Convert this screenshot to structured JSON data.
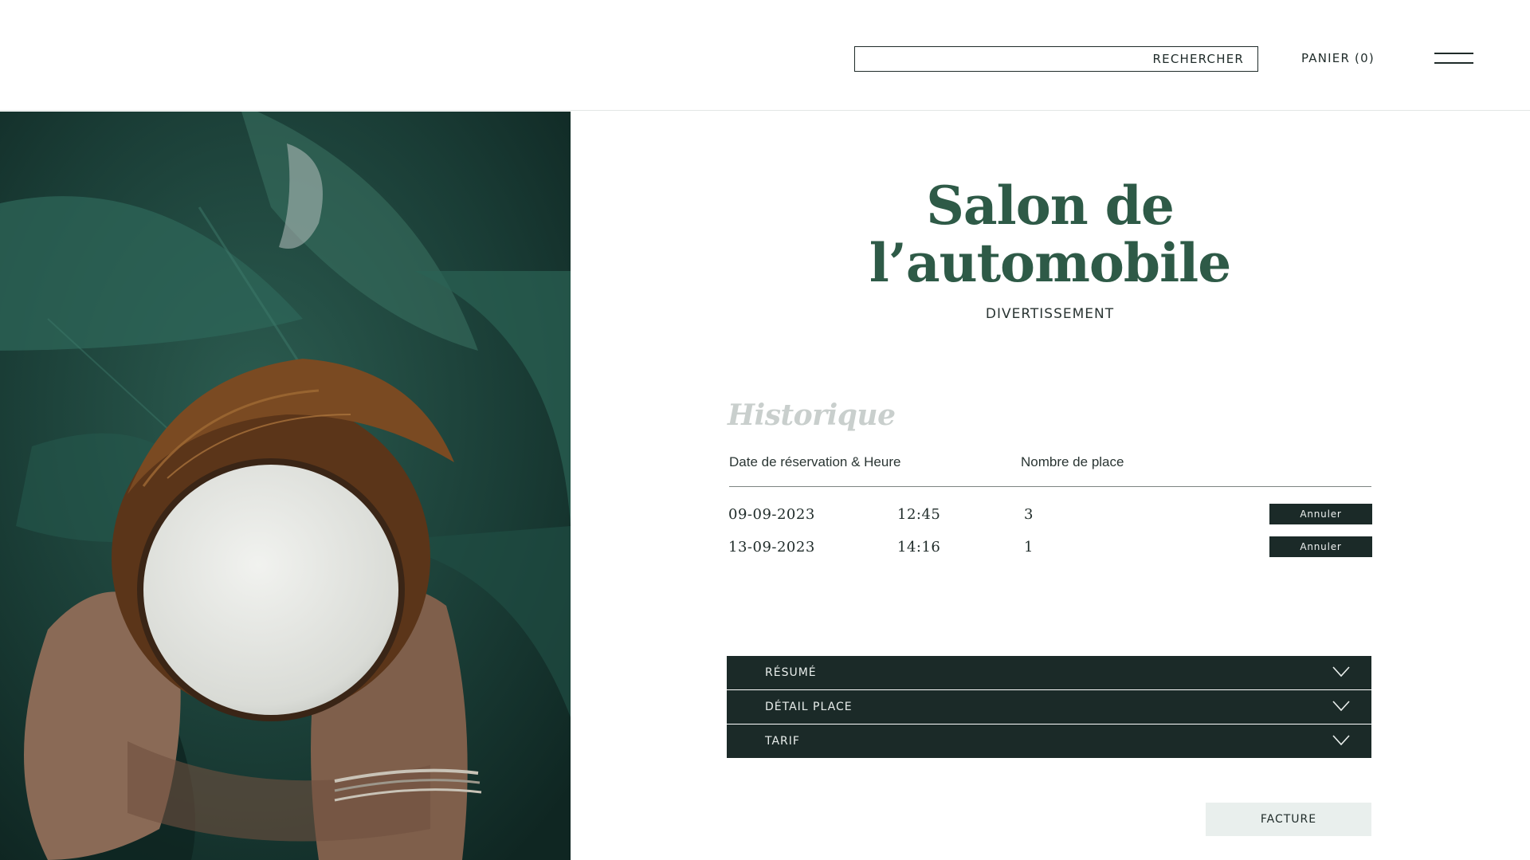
{
  "header": {
    "search_placeholder": "",
    "search_label": "RECHERCHER",
    "cart_label": "PANIER (0)",
    "menu_icon": "hamburger-menu-icon"
  },
  "event": {
    "title_line1": "Salon de",
    "title_line2": "l’automobile",
    "category": "DIVERTISSEMENT"
  },
  "history": {
    "heading": "Historique",
    "columns": {
      "date": "Date de réservation & Heure",
      "seats": "Nombre de place"
    },
    "rows": [
      {
        "date": "09-09-2023",
        "time": "12:45",
        "seats": "3",
        "action": "Annuler"
      },
      {
        "date": "13-09-2023",
        "time": "14:16",
        "seats": "1",
        "action": "Annuler"
      }
    ]
  },
  "accordion": [
    {
      "label": "RÉSUMÉ",
      "icon": "chevron-down-icon"
    },
    {
      "label": "DÉTAIL PLACE",
      "icon": "chevron-down-icon"
    },
    {
      "label": "TARIF",
      "icon": "chevron-down-icon"
    }
  ],
  "invoice_label": "FACTURE",
  "colors": {
    "title_green": "#2e5a47",
    "dark_panel": "#1b2a28",
    "invoice_bg": "#e9efed"
  }
}
